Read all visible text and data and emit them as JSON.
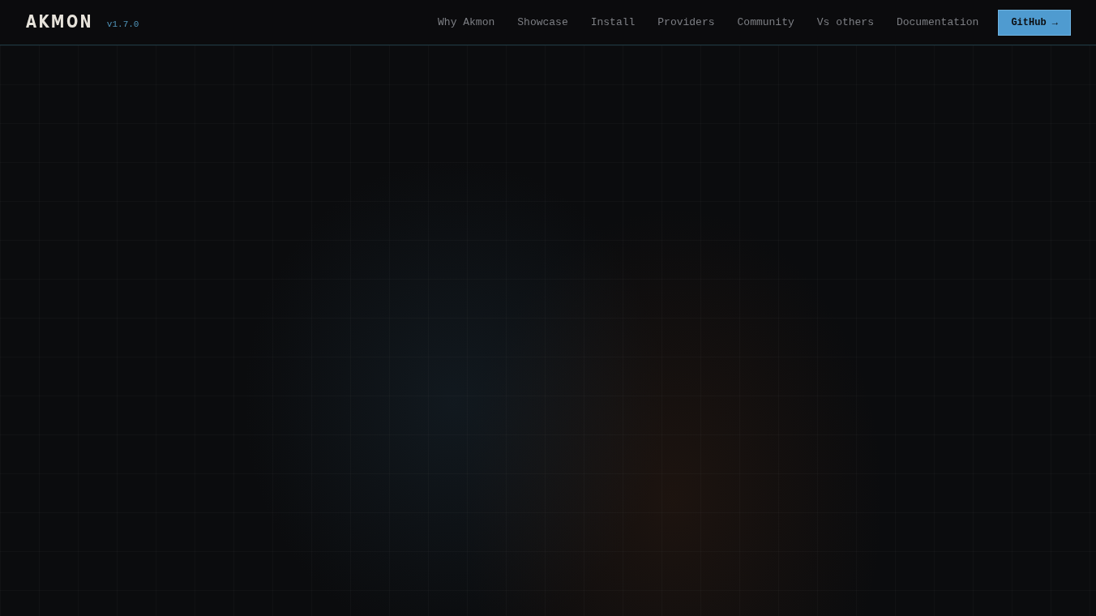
{
  "brand": {
    "name": "AKMON",
    "version": "v1.7.0"
  },
  "nav": [
    {
      "label": "Why Akmon"
    },
    {
      "label": "Showcase"
    },
    {
      "label": "Install"
    },
    {
      "label": "Providers"
    },
    {
      "label": "Community"
    },
    {
      "label": "Vs others"
    },
    {
      "label": "Documentation"
    }
  ],
  "cta": {
    "label": "GitHub →"
  }
}
